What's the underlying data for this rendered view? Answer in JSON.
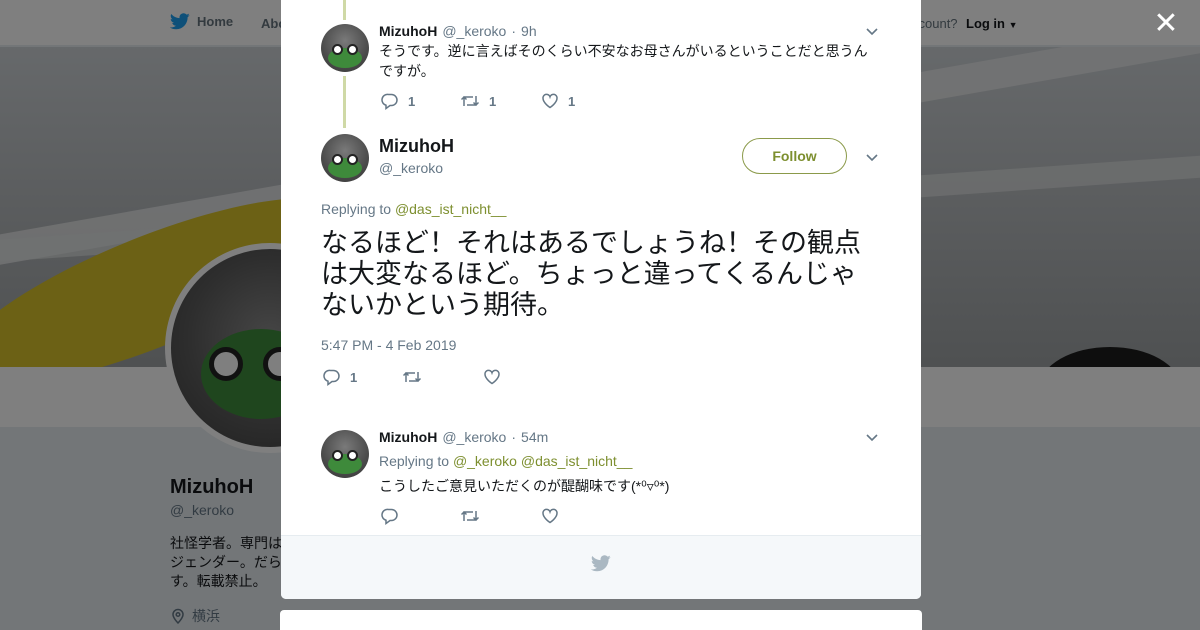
{
  "topbar": {
    "home_label": "Home",
    "about_label": "Abo",
    "account_label": "ccount?",
    "login_label": "Log in"
  },
  "profile": {
    "name": "MizuhoH",
    "handle": "@_keroko",
    "bio": "社怪学者。専門は\nジェンダー。だら\nす。転載禁止。",
    "location": "横浜"
  },
  "tweets": [
    {
      "name": "MizuhoH",
      "handle": "@_keroko",
      "dot": "·",
      "time": "9h",
      "text": "そうです。逆に言えばそのくらい不安なお母さんがいるということだと思うんですが。",
      "replies": "1",
      "retweets": "1",
      "likes": "1"
    },
    {
      "name": "MizuhoH",
      "handle": "@_keroko",
      "follow_label": "Follow",
      "replying_prefix": "Replying to",
      "replying_to": "@das_ist_nicht__",
      "text": "なるほど！それはあるでしょうね！その観点は大変なるほど。ちょっと違ってくるんじゃないかという期待。",
      "timestamp": "5:47 PM - 4 Feb 2019",
      "replies": "1"
    },
    {
      "name": "MizuhoH",
      "handle": "@_keroko",
      "dot": "·",
      "time": "54m",
      "replying_prefix": "Replying to",
      "replying_to_1": "@_keroko",
      "replying_to_2": "@das_ist_nicht__",
      "text": "こうしたご意見いただくのが醍醐味です(*⁰▿⁰*)"
    }
  ],
  "colors": {
    "accent": "#7d8f2f",
    "thread_line": "#cfd9a6",
    "muted": "#657786",
    "twitter_blue": "#1da1f2"
  },
  "icons": [
    "twitter-bird-icon",
    "close-icon",
    "chevron-down-icon",
    "reply-icon",
    "retweet-icon",
    "like-icon",
    "location-pin-icon",
    "caret-down-icon"
  ]
}
